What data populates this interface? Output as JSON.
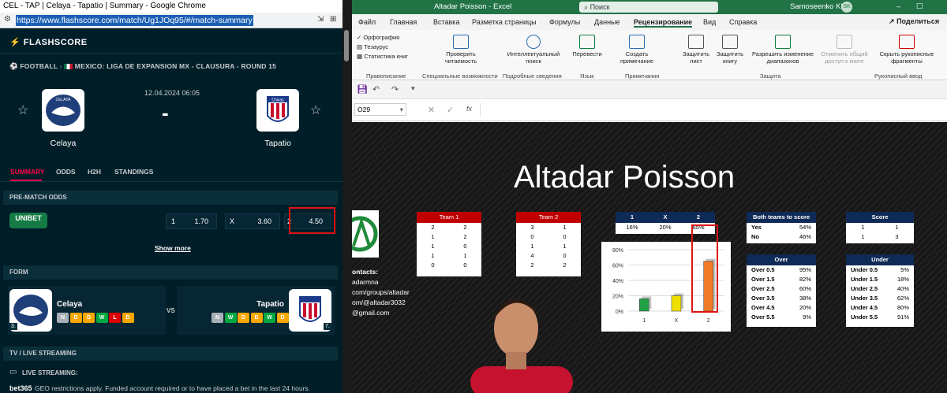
{
  "chrome": {
    "title": "CEL - TAP | Celaya - Tapatio | Summary - Google Chrome",
    "url": "https://www.flashscore.com/match/Ug1JOq95/#/match-summary",
    "logo": "FLASHSCORE",
    "breadcrumb": {
      "sport": "FOOTBALL",
      "league": "MEXICO: LIGA DE EXPANSION MX - CLAUSURA - ROUND 15"
    },
    "match": {
      "date": "12.04.2024 06:05",
      "score": "-",
      "home": "Celaya",
      "away": "Tapatio",
      "home_badge": "CELAYA",
      "away_badge": "Chivas"
    },
    "tabs": [
      "SUMMARY",
      "ODDS",
      "H2H",
      "STANDINGS"
    ],
    "prematch": {
      "title": "PRE-MATCH ODDS",
      "bookmaker": "UNIBET",
      "odds": [
        {
          "label": "1",
          "value": "1.70"
        },
        {
          "label": "X",
          "value": "3.60"
        },
        {
          "label": "2",
          "value": "4.50"
        }
      ],
      "show_more": "Show more"
    },
    "form": {
      "title": "FORM",
      "vs": "VS",
      "home": {
        "name": "Celaya",
        "rank": "3.",
        "results": [
          "N",
          "D",
          "D",
          "W",
          "L",
          "D"
        ]
      },
      "away": {
        "name": "Tapatio",
        "rank": "7.",
        "results": [
          "N",
          "W",
          "D",
          "D",
          "W",
          "D"
        ]
      }
    },
    "tv": {
      "title": "TV / LIVE STREAMING",
      "live": "LIVE STREAMING:",
      "bet365": "bet365",
      "bet365_text": "GEO restrictions apply. Funded account required or to have placed a bet in the last 24 hours."
    }
  },
  "excel": {
    "title": "Altadar Poisson  -  Excel",
    "search": "Поиск",
    "user": "Samoseenko Klim",
    "user_initials": "SK",
    "menu": [
      "Файл",
      "Главная",
      "Вставка",
      "Разметка страницы",
      "Формулы",
      "Данные",
      "Рецензирование",
      "Вид",
      "Справка"
    ],
    "share": "Поделиться",
    "ribbon": {
      "spelling": "Орфография",
      "thesaurus": "Тезаурус",
      "stats": "Статистика книг",
      "check_access": "Проверить читаемость",
      "smart_search": "Интеллектуальный поиск",
      "translate": "Перевести",
      "new_note": "Создать примечание",
      "protect_sheet": "Защитить лист",
      "protect_book": "Защитить книгу",
      "allow_edit": "Разрешить изменение диапазонов",
      "unshare": "Отменить общий доступ к книге",
      "hide_ink": "Скрыть рукописные фрагменты",
      "groups": [
        "Правописание",
        "Специальные возможности",
        "Подробные сведения",
        "Язык",
        "Примечания",
        "Защита",
        "Рукописный ввод"
      ]
    },
    "cell_ref": "O29",
    "fx": "fx",
    "sheet": {
      "title": "Altadar Poisson",
      "team1": {
        "header": "Team 1",
        "rows": [
          [
            "2",
            "2"
          ],
          [
            "1",
            "2"
          ],
          [
            "1",
            "0"
          ],
          [
            "1",
            "1"
          ],
          [
            "0",
            "0"
          ]
        ]
      },
      "team2": {
        "header": "Team 2",
        "rows": [
          [
            "3",
            "1"
          ],
          [
            "0",
            "0"
          ],
          [
            "1",
            "1"
          ],
          [
            "4",
            "0"
          ],
          [
            "2",
            "2"
          ]
        ]
      },
      "probs": {
        "headers": [
          "1",
          "X",
          "2"
        ],
        "values": [
          "16%",
          "20%",
          "65%"
        ]
      },
      "btts": {
        "header": "Both teams to score",
        "rows": [
          [
            "Yes",
            "54%"
          ],
          [
            "No",
            "46%"
          ]
        ]
      },
      "score": {
        "header": "Score",
        "rows": [
          [
            "1",
            "1"
          ],
          [
            "1",
            "3"
          ]
        ]
      },
      "over": {
        "header": "Over",
        "rows": [
          [
            "Over 0.5",
            "95%"
          ],
          [
            "Over 1.5",
            "82%"
          ],
          [
            "Over 2.5",
            "60%"
          ],
          [
            "Over 3.5",
            "38%"
          ],
          [
            "Over 4.5",
            "20%"
          ],
          [
            "Over 5.5",
            "9%"
          ]
        ]
      },
      "under": {
        "header": "Under",
        "rows": [
          [
            "Under 0.5",
            "5%"
          ],
          [
            "Under 1.5",
            "18%"
          ],
          [
            "Under 2.5",
            "40%"
          ],
          [
            "Under 3.5",
            "62%"
          ],
          [
            "Under 4.5",
            "80%"
          ],
          [
            "Under 5.5",
            "91%"
          ]
        ]
      },
      "contacts": [
        "ontacts:",
        "adarmna",
        "com/groups/altadar",
        "om/@altadar3032",
        "@gmail.com"
      ]
    }
  },
  "chart_data": {
    "type": "bar",
    "categories": [
      "1",
      "X",
      "2"
    ],
    "values": [
      16,
      20,
      65
    ],
    "ylim": [
      0,
      80
    ],
    "yticks": [
      "80%",
      "60%",
      "40%",
      "20%",
      "0%"
    ],
    "colors": [
      "#22a046",
      "#f0e000",
      "#f07a28"
    ]
  }
}
